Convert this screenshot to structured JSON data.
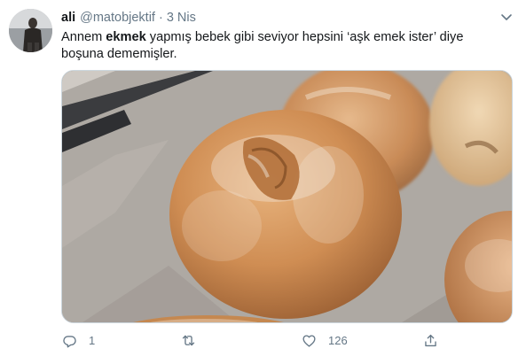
{
  "tweet": {
    "author_name": "ali",
    "author_handle": "@matobjektif",
    "separator": "·",
    "timestamp": "3 Nis",
    "text": {
      "before": "Annem ",
      "highlight": "ekmek",
      "after": " yapmış bebek gibi seviyor hepsini ‘aşk emek ister’ diye boşuna dememişler."
    },
    "media": {
      "icon": "bread-photo"
    },
    "actions": {
      "reply_count": "1",
      "retweet_count": "",
      "like_count": "126",
      "share_count": ""
    }
  },
  "icons": {
    "reply": "speech-bubble-icon",
    "retweet": "retweet-arrows-icon",
    "like": "heart-outline-icon",
    "share": "share-upload-icon",
    "more": "chevron-down-icon"
  },
  "colors": {
    "text_primary": "#14171a",
    "text_secondary": "#657786",
    "border": "#ccd6dd"
  }
}
